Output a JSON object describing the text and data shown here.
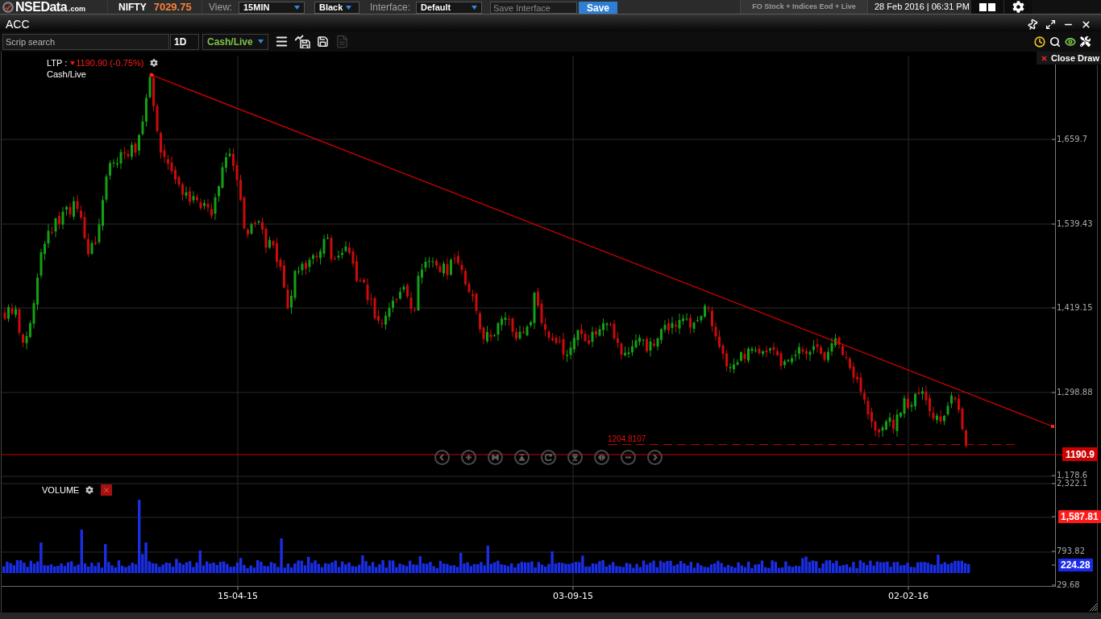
{
  "top_bar": {
    "logo": {
      "name": "NSEData",
      "suffix": ".com"
    },
    "index": {
      "name": "NIFTY",
      "value": "7029.75"
    },
    "view": {
      "label": "View:",
      "value": "15MIN"
    },
    "theme": {
      "value": "Black"
    },
    "interface": {
      "label": "Interface:",
      "value": "Default"
    },
    "save_interface": {
      "placeholder": "Save Interface"
    },
    "save_button": "Save",
    "feed": "FO Stock + Indices Eod + Live",
    "datetime": "28 Feb 2016 | 06:31 PM"
  },
  "window": {
    "title": "ACC"
  },
  "toolbar": {
    "search": {
      "placeholder": "Scrip search"
    },
    "period": "1D",
    "segment": "Cash/Live",
    "tools": [
      {
        "kind": "menu",
        "disabled": false
      },
      {
        "kind": "chart-save",
        "disabled": false
      },
      {
        "kind": "save",
        "disabled": false
      },
      {
        "kind": "csv",
        "disabled": true
      }
    ]
  },
  "chart": {
    "close_drawing": "Close Draw",
    "legend": {
      "label": "LTP :",
      "falling": true,
      "change": "1190.90 (-0.75%)",
      "series": "Cash/Live"
    },
    "price_axis": [
      "1,659.7",
      "1,539.43",
      "1,419.15",
      "1,298.88",
      "1,178.6"
    ],
    "last_price": "1190.9",
    "level_line": "1204.8107"
  },
  "volume": {
    "title": "VOLUME",
    "axis": [
      {
        "kind": "tick",
        "label": "2,322.1"
      },
      {
        "kind": "flag",
        "label": "1,587.81",
        "color": "#ff1a1a"
      },
      {
        "kind": "tick",
        "label": "793.82"
      },
      {
        "kind": "flag",
        "label": "224.28",
        "color": "#1a2ae8"
      },
      {
        "kind": "tick",
        "label": "29.68"
      }
    ]
  },
  "x_axis": [
    "15-04-15",
    "03-09-15",
    "02-02-16"
  ]
}
